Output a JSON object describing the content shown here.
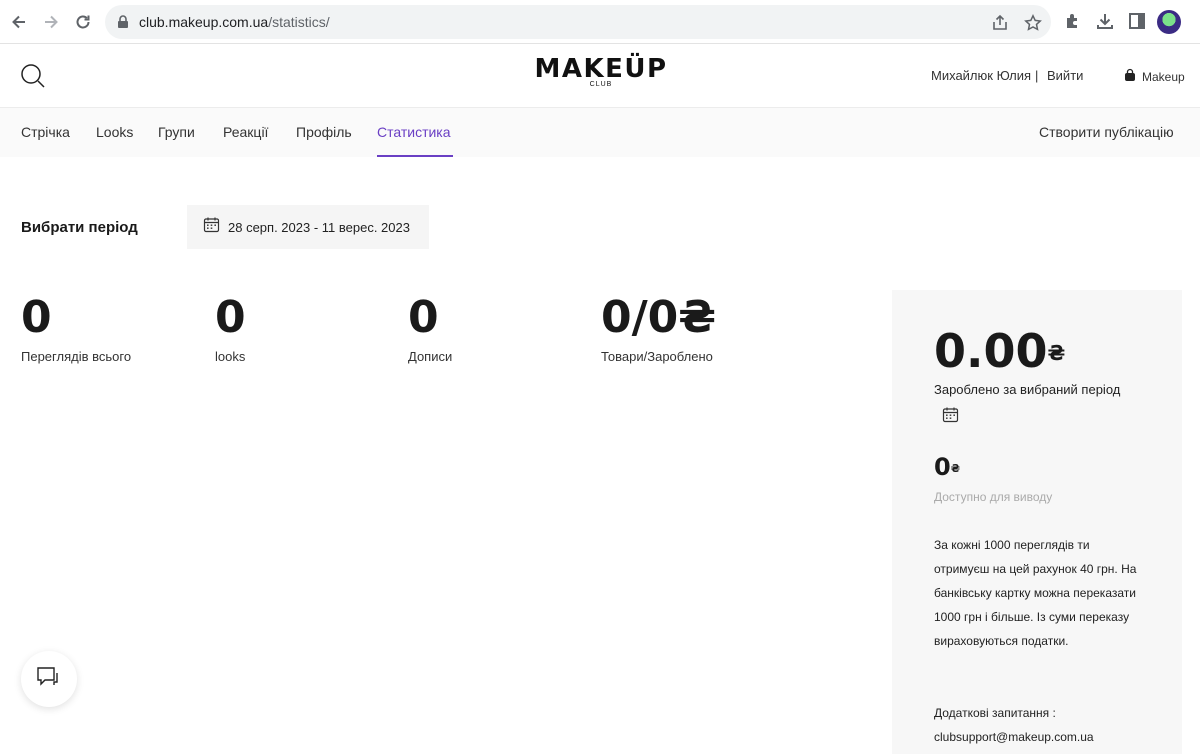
{
  "browser": {
    "url_domain": "club.makeup.com.ua",
    "url_path": "/statistics/"
  },
  "header": {
    "brand": "MAKEÜP",
    "brand_sub": "CLUB",
    "user_name": "Михайлюк Юлия",
    "separator": "|",
    "logout": "Вийти",
    "shop": "Makeup"
  },
  "tabs": [
    {
      "label": "Стрічка"
    },
    {
      "label": "Looks"
    },
    {
      "label": "Групи"
    },
    {
      "label": "Реакції"
    },
    {
      "label": "Профіль"
    },
    {
      "label": "Статистика",
      "active": true
    }
  ],
  "create_post": "Створити публікацію",
  "period": {
    "label": "Вибрати період",
    "value": "28 серп. 2023 - 11 верес. 2023"
  },
  "stats": [
    {
      "value": "0",
      "label": "Переглядів всього"
    },
    {
      "value": "0",
      "label": "looks"
    },
    {
      "value": "0",
      "label": "Дописи"
    },
    {
      "value": "0/0₴",
      "label": "Товари/Зароблено"
    }
  ],
  "panel": {
    "earned_value": "0.00",
    "currency": "₴",
    "earned_label": "Зароблено за вибраний період",
    "available_value": "0",
    "available_label": "Доступно для виводу",
    "info": "За кожні 1000 переглядів ти отримуєш на цей рахунок 40 грн. На банківську картку можна переказати 1000 грн і більше. Із суми переказу вираховуються податки.",
    "extra_label": "Додаткові запитання :",
    "support_email": "clubsupport@makeup.com.ua"
  },
  "colors": {
    "accent": "#6a3fc4"
  }
}
